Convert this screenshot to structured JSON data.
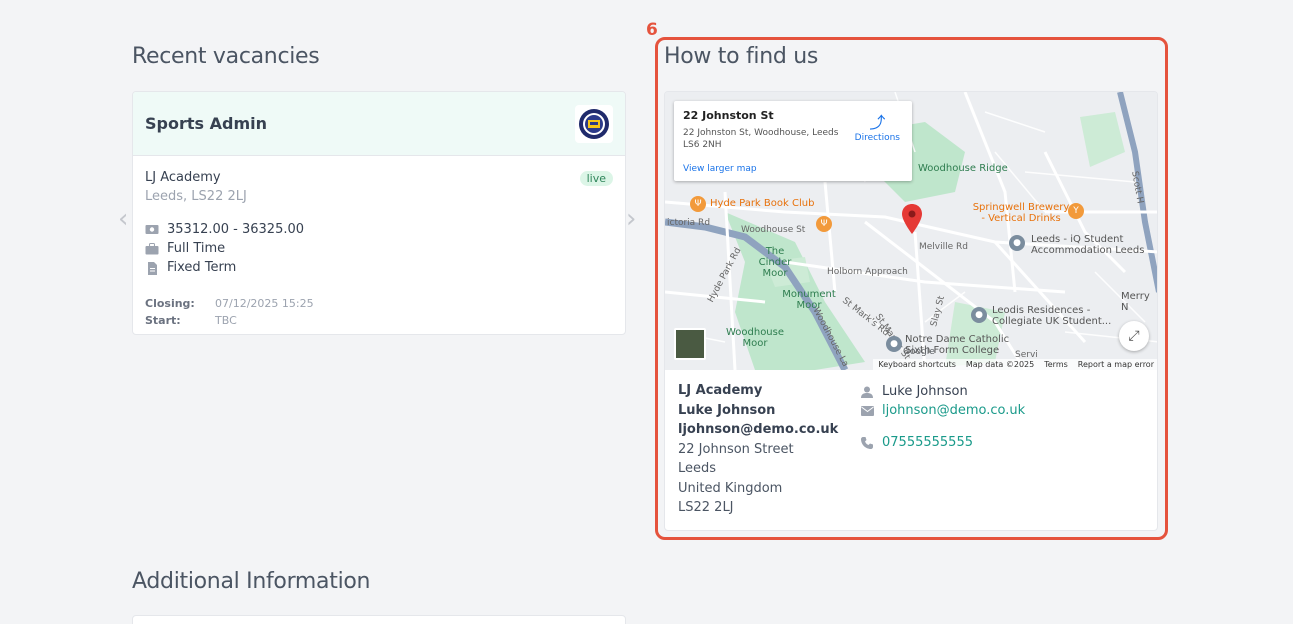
{
  "recent": {
    "title": "Recent vacancies",
    "card": {
      "title": "Sports Admin",
      "organisation": "LJ Academy",
      "location": "Leeds, LS22 2LJ",
      "status": "live",
      "salary": "35312.00 - 36325.00",
      "hours": "Full Time",
      "contract": "Fixed Term",
      "closing_label": "Closing:",
      "closing_value": "07/12/2025 15:25",
      "start_label": "Start:",
      "start_value": "TBC"
    }
  },
  "find_us": {
    "highlight_number": "6",
    "title": "How to find us",
    "map": {
      "place_title": "22 Johnston St",
      "place_address": "22 Johnston St, Woodhouse, Leeds LS6 2NH",
      "directions_label": "Directions",
      "larger_map_link": "View larger map",
      "labels": {
        "woodhouse_ridge": "Woodhouse Ridge",
        "hyde_park_book_club": "Hyde Park Book Club",
        "springwell_brewery": "Springwell Brewery - Vertical Drinks",
        "leeds_iq": "Leeds - iQ Student Accommodation Leeds",
        "cinder_moor": "The Cinder Moor",
        "monument_moor": "Monument Moor",
        "woodhouse_moor": "Woodhouse Moor",
        "leodis": "Leodis Residences - Collegiate UK Student...",
        "notre_dame": "Notre Dame Catholic Sixth Form College",
        "merry": "Merry N",
        "victoria_rd": "ictoria Rd",
        "woodhouse_st": "Woodhouse St",
        "holborn": "Holborn Approach",
        "melville": "Melville Rd",
        "hyde_park_rd": "Hyde Park Rd",
        "st_marks_rd": "St Mark's Rd",
        "st_marks_st": "St Mark's St",
        "slay_st": "Slay St",
        "woodhouse_la": "Woodhouse La",
        "service": "Servi",
        "scott": "Scott H"
      },
      "footer": {
        "shortcuts": "Keyboard shortcuts",
        "map_data": "Map data ©2025",
        "terms": "Terms",
        "report": "Report a map error"
      },
      "google": "Google"
    },
    "address": {
      "organisation": "LJ Academy",
      "contact_name": "Luke Johnson",
      "email": "ljohnson@demo.co.uk",
      "street": "22 Johnson Street",
      "city": "Leeds",
      "country": "United Kingdom",
      "postcode": "LS22 2LJ"
    },
    "contact": {
      "name": "Luke Johnson",
      "email": "ljohnson@demo.co.uk",
      "phone": "07555555555"
    }
  },
  "additional": {
    "title": "Additional Information"
  },
  "colors": {
    "accent_teal": "#1a9a8a",
    "highlight_red": "#e5533d",
    "card_header": "#effaf7"
  }
}
